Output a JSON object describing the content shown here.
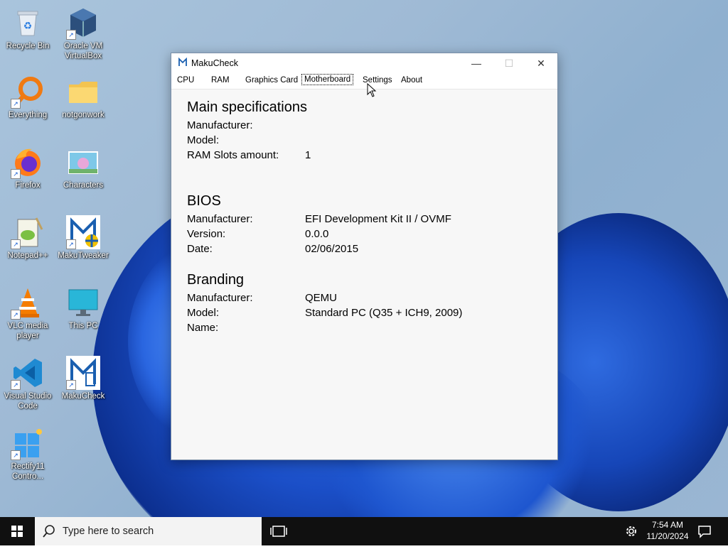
{
  "desktop": {
    "icons": [
      {
        "label": "Recycle Bin",
        "icon": "recycle-bin-icon",
        "shortcut": false
      },
      {
        "label": "Oracle VM VirtualBox",
        "icon": "virtualbox-icon",
        "shortcut": true
      },
      {
        "label": "Everything",
        "icon": "everything-search-icon",
        "shortcut": true
      },
      {
        "label": "notgonwork",
        "icon": "folder-icon",
        "shortcut": false
      },
      {
        "label": "Firefox",
        "icon": "firefox-icon",
        "shortcut": true
      },
      {
        "label": "Characters",
        "icon": "image-file-icon",
        "shortcut": false
      },
      {
        "label": "Notepad++",
        "icon": "notepad-plus-plus-icon",
        "shortcut": true
      },
      {
        "label": "MakuTweaker",
        "icon": "makutweaker-icon",
        "shortcut": true
      },
      {
        "label": "VLC media player",
        "icon": "vlc-icon",
        "shortcut": true
      },
      {
        "label": "This PC",
        "icon": "this-pc-icon",
        "shortcut": false
      },
      {
        "label": "Visual Studio Code",
        "icon": "vscode-icon",
        "shortcut": true
      },
      {
        "label": "MakuCheck",
        "icon": "makucheck-icon",
        "shortcut": true
      },
      {
        "label": "Rectify11 Contro...",
        "icon": "rectify11-icon",
        "shortcut": true
      }
    ]
  },
  "window": {
    "title": "MakuCheck",
    "controls": {
      "minimize": "—",
      "maximize": "☐",
      "close": "✕"
    },
    "tabs": [
      {
        "label": "CPU",
        "active": false
      },
      {
        "label": "RAM",
        "active": false
      },
      {
        "label": "Graphics Card",
        "active": false
      },
      {
        "label": "Motherboard",
        "active": true
      },
      {
        "label": "Settings",
        "active": false
      },
      {
        "label": "About",
        "active": false
      }
    ],
    "sections": {
      "main": {
        "heading": "Main specifications",
        "manufacturer_label": "Manufacturer:",
        "manufacturer_value": "",
        "model_label": "Model:",
        "model_value": "",
        "ram_slots_label": "RAM Slots amount:",
        "ram_slots_value": "1"
      },
      "bios": {
        "heading": "BIOS",
        "manufacturer_label": "Manufacturer:",
        "manufacturer_value": "EFI Development Kit II / OVMF",
        "version_label": "Version:",
        "version_value": "0.0.0",
        "date_label": "Date:",
        "date_value": "02/06/2015"
      },
      "branding": {
        "heading": "Branding",
        "manufacturer_label": "Manufacturer:",
        "manufacturer_value": "QEMU",
        "model_label": "Model:",
        "model_value": "Standard PC (Q35 + ICH9, 2009)",
        "name_label": "Name:",
        "name_value": ""
      }
    }
  },
  "taskbar": {
    "search_placeholder": "Type here to search",
    "time": "7:54 AM",
    "date": "11/20/2024"
  },
  "colors": {
    "accent": "#1b4fc8",
    "taskbar": "#101010",
    "window_bg": "#f7f7f7"
  }
}
